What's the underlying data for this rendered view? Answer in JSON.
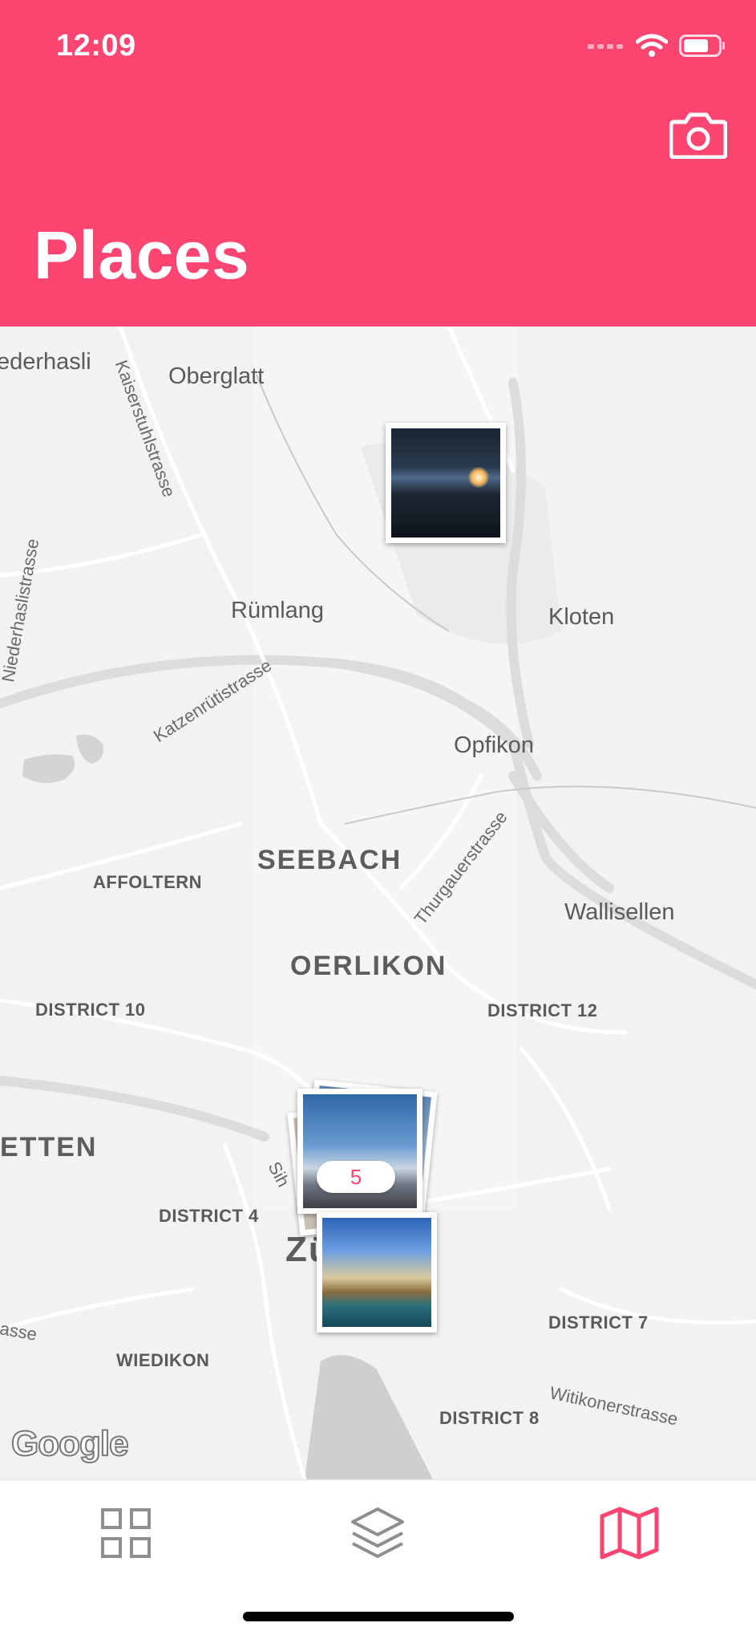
{
  "status_bar": {
    "time": "12:09"
  },
  "header": {
    "title": "Places",
    "camera_icon": "camera-icon"
  },
  "map": {
    "towns": [
      "ederhasli",
      "Oberglatt",
      "Rümlang",
      "Kloten",
      "Opfikon",
      "Wallisellen"
    ],
    "big_districts": [
      "SEEBACH",
      "OERLIKON"
    ],
    "districts": [
      "AFFOLTERN",
      "DISTRICT 10",
      "DISTRICT 12",
      "ETTEN",
      "DISTRICT 4",
      "Zü",
      "DISTRICT 7",
      "WIEDIKON",
      "DISTRICT 8"
    ],
    "streets": [
      "Kaiserstuhlstrasse",
      "Niederhaslistrasse",
      "Katzenrütistrasse",
      "Thurgauerstrasse",
      "Witikonerstrasse",
      "Sih",
      "asse"
    ],
    "cluster_count": "5",
    "attribution": "Google"
  },
  "tabbar": {
    "tabs": [
      {
        "icon": "grid-icon",
        "active": false
      },
      {
        "icon": "layers-icon",
        "active": false
      },
      {
        "icon": "map-icon",
        "active": true
      }
    ],
    "active_color": "#fc4571",
    "inactive_color": "#8e8e8e"
  },
  "colors": {
    "accent": "#fc4571"
  }
}
